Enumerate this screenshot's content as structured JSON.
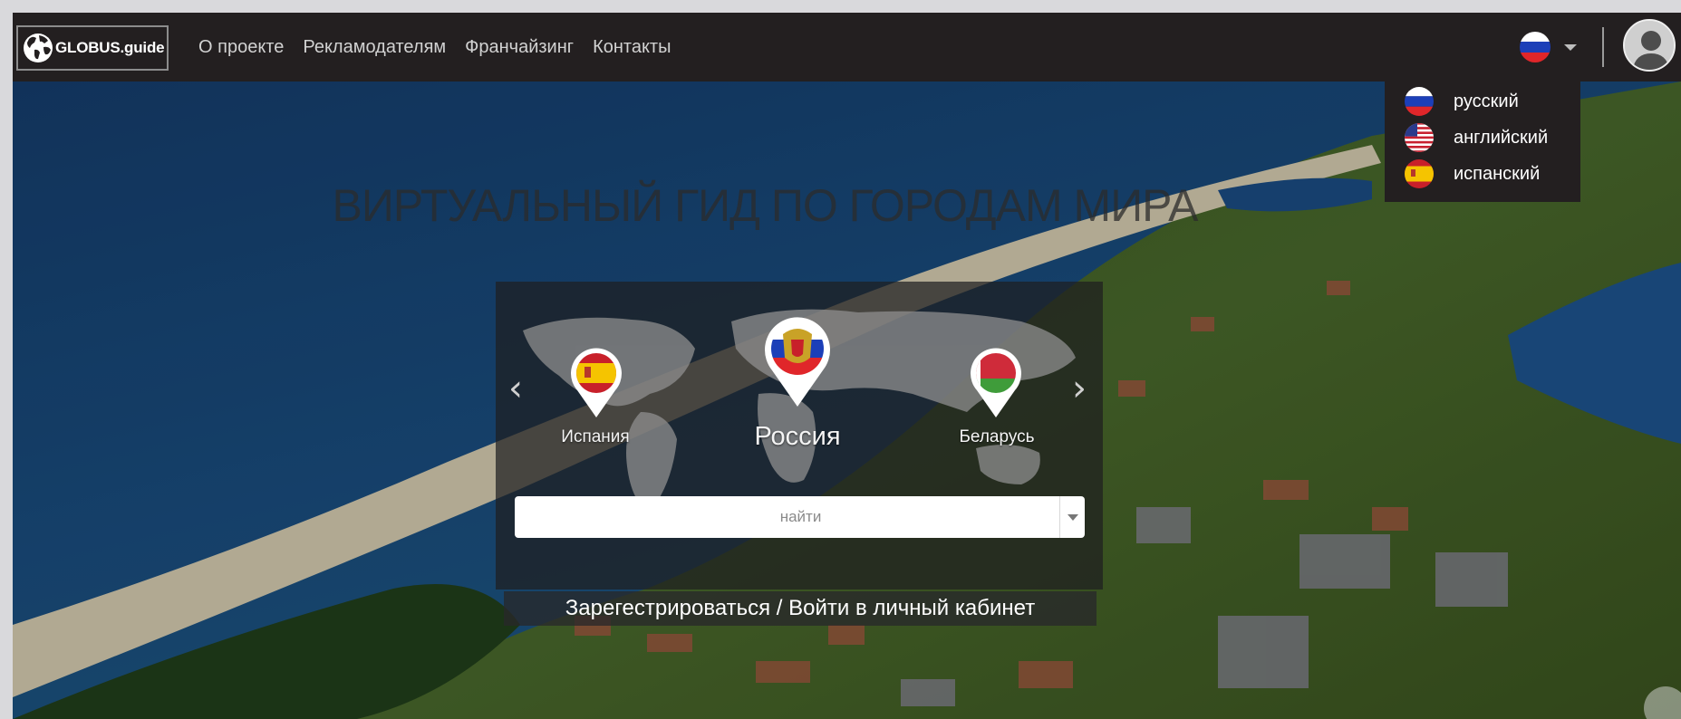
{
  "header": {
    "logo_text": "GLOBUS.guide",
    "nav": [
      {
        "label": "О проекте"
      },
      {
        "label": "Рекламодателям"
      },
      {
        "label": "Франчайзинг"
      },
      {
        "label": "Контакты"
      }
    ],
    "current_language_icon": "russia-flag-icon",
    "avatar_icon": "user-avatar-icon"
  },
  "language_menu": {
    "items": [
      {
        "label": "русский",
        "icon": "russia-flag-icon"
      },
      {
        "label": "английский",
        "icon": "usa-flag-icon"
      },
      {
        "label": "испанский",
        "icon": "spain-flag-icon"
      }
    ]
  },
  "hero": {
    "title": "ВИРТУАЛЬНЫЙ ГИД ПО ГОРОДАМ МИРА"
  },
  "carousel": {
    "prev_icon": "chevron-left-icon",
    "next_icon": "chevron-right-icon",
    "countries": [
      {
        "name": "Испания",
        "icon": "spain-flag-pin-icon"
      },
      {
        "name": "Россия",
        "icon": "russia-coat-of-arms-pin-icon"
      },
      {
        "name": "Беларусь",
        "icon": "belarus-flag-pin-icon"
      }
    ]
  },
  "search": {
    "placeholder": "найти",
    "value": ""
  },
  "register": {
    "label": "Зарегестрироваться / Войти в личный кабинет"
  },
  "colors": {
    "header_bg": "#231f20",
    "nav_text": "#d2d2d2",
    "panel_bg": "rgba(30,30,32,0.72)"
  }
}
